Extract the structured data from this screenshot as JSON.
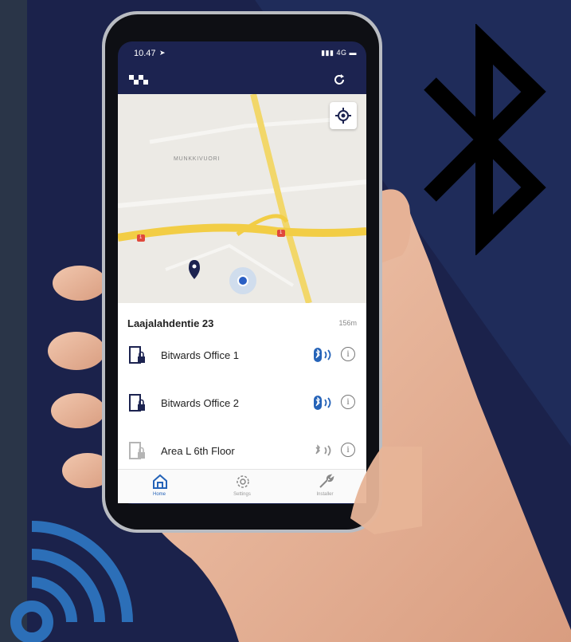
{
  "status_bar": {
    "time": "10.47",
    "signal": "4G"
  },
  "map": {
    "area_label": "MUNKKIVUORI",
    "road_shield_1": "1",
    "road_shield_2": "1"
  },
  "location": {
    "name": "Laajalahdentie 23",
    "distance": "156m"
  },
  "doors": [
    {
      "name": "Bitwards Office 1",
      "lock_icon": "door-lock-icon",
      "bluetooth": "in-range"
    },
    {
      "name": "Bitwards Office 2",
      "lock_icon": "door-lock-icon",
      "bluetooth": "in-range"
    },
    {
      "name": "Area L 6th Floor",
      "lock_icon": "door-lock-icon",
      "bluetooth": "out-of-range"
    }
  ],
  "tabs": [
    {
      "label": "Home",
      "icon": "home-icon",
      "active": true
    },
    {
      "label": "Settings",
      "icon": "gear-icon",
      "active": false
    },
    {
      "label": "Installer",
      "icon": "wrench-icon",
      "active": false
    }
  ],
  "colors": {
    "navy": "#1c2350",
    "accent_blue": "#2563b8",
    "background": "#2a3548",
    "map_road": "#f3d25a"
  }
}
